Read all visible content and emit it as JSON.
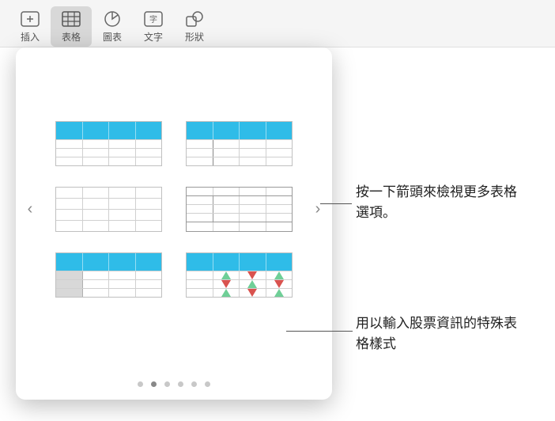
{
  "toolbar": {
    "items": [
      {
        "label": "插入",
        "icon": "plus-box"
      },
      {
        "label": "表格",
        "icon": "grid",
        "active": true
      },
      {
        "label": "圖表",
        "icon": "pie"
      },
      {
        "label": "文字",
        "icon": "text-box"
      },
      {
        "label": "形狀",
        "icon": "shapes"
      }
    ]
  },
  "popover": {
    "prev_label": "‹",
    "next_label": "›",
    "options": [
      {
        "name": "blue-header-table"
      },
      {
        "name": "blue-header-split-table"
      },
      {
        "name": "plain-table"
      },
      {
        "name": "inner-border-table"
      },
      {
        "name": "row-header-table"
      },
      {
        "name": "stock-info-table"
      }
    ],
    "page_count": 6,
    "active_page": 1
  },
  "annotations": {
    "arrow_hint": "按一下箭頭來檢視更多表格選項。",
    "stock_hint": "用以輸入股票資訊的特殊表格樣式"
  }
}
